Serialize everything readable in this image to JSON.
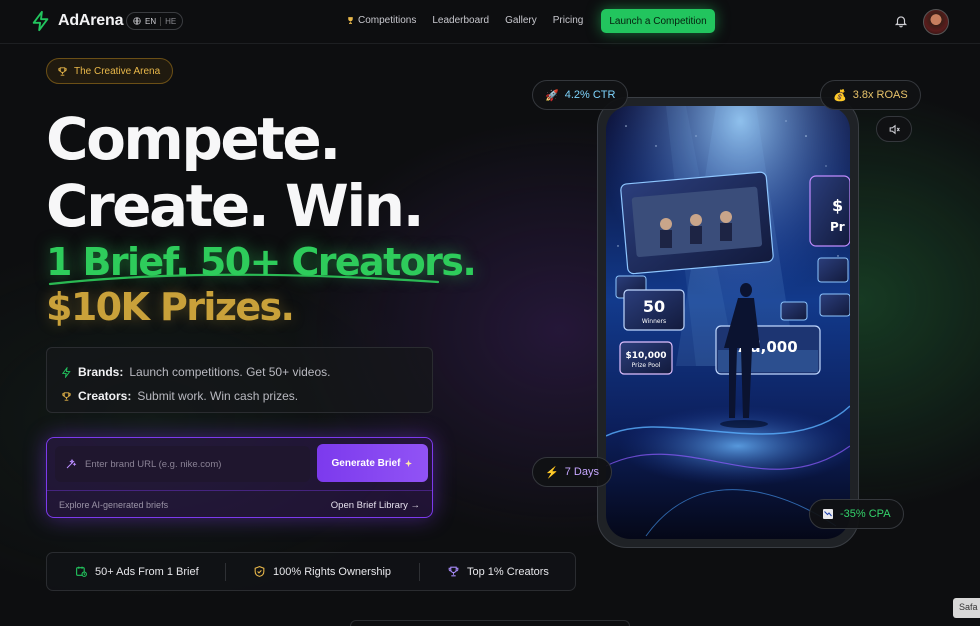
{
  "nav": {
    "brand": "AdArena",
    "lang_active": "EN",
    "lang_other": "HE",
    "links": [
      "Competitions",
      "Leaderboard",
      "Gallery",
      "Pricing"
    ],
    "cta": "Launch a Competition"
  },
  "hero": {
    "badge": "The Creative Arena",
    "line1": "Compete.",
    "line2": "Create. Win.",
    "line3": "1 Brief. 50+ Creators.",
    "line4": "$10K Prizes."
  },
  "info": {
    "brands_label": "Brands:",
    "brands_text": "Launch competitions. Get 50+ videos.",
    "creators_label": "Creators:",
    "creators_text": "Submit work. Win cash prizes."
  },
  "brief": {
    "placeholder": "Enter brand URL (e.g. nike.com)",
    "button": "Generate Brief",
    "explore": "Explore AI-generated briefs",
    "library": "Open Brief Library →"
  },
  "stats": [
    "50+ Ads From 1 Brief",
    "100% Rights Ownership",
    "Top 1% Creators"
  ],
  "phone": {
    "card_50": "50",
    "card_winners": "Winners",
    "card_prize": "$10,000",
    "card_prize_pool": "Prize Pool",
    "card_ad": "Ad,000",
    "card_side": "$",
    "card_side2": "Pr"
  },
  "metrics": {
    "ctr": "4.2% CTR",
    "roas": "3.8x ROAS",
    "days": "7 Days",
    "cpa": "-35% CPA"
  },
  "browser_hint": "Safa",
  "colors": {
    "green": "#22c55e",
    "gold": "#c9a13a",
    "purple": "#7c3aed"
  }
}
